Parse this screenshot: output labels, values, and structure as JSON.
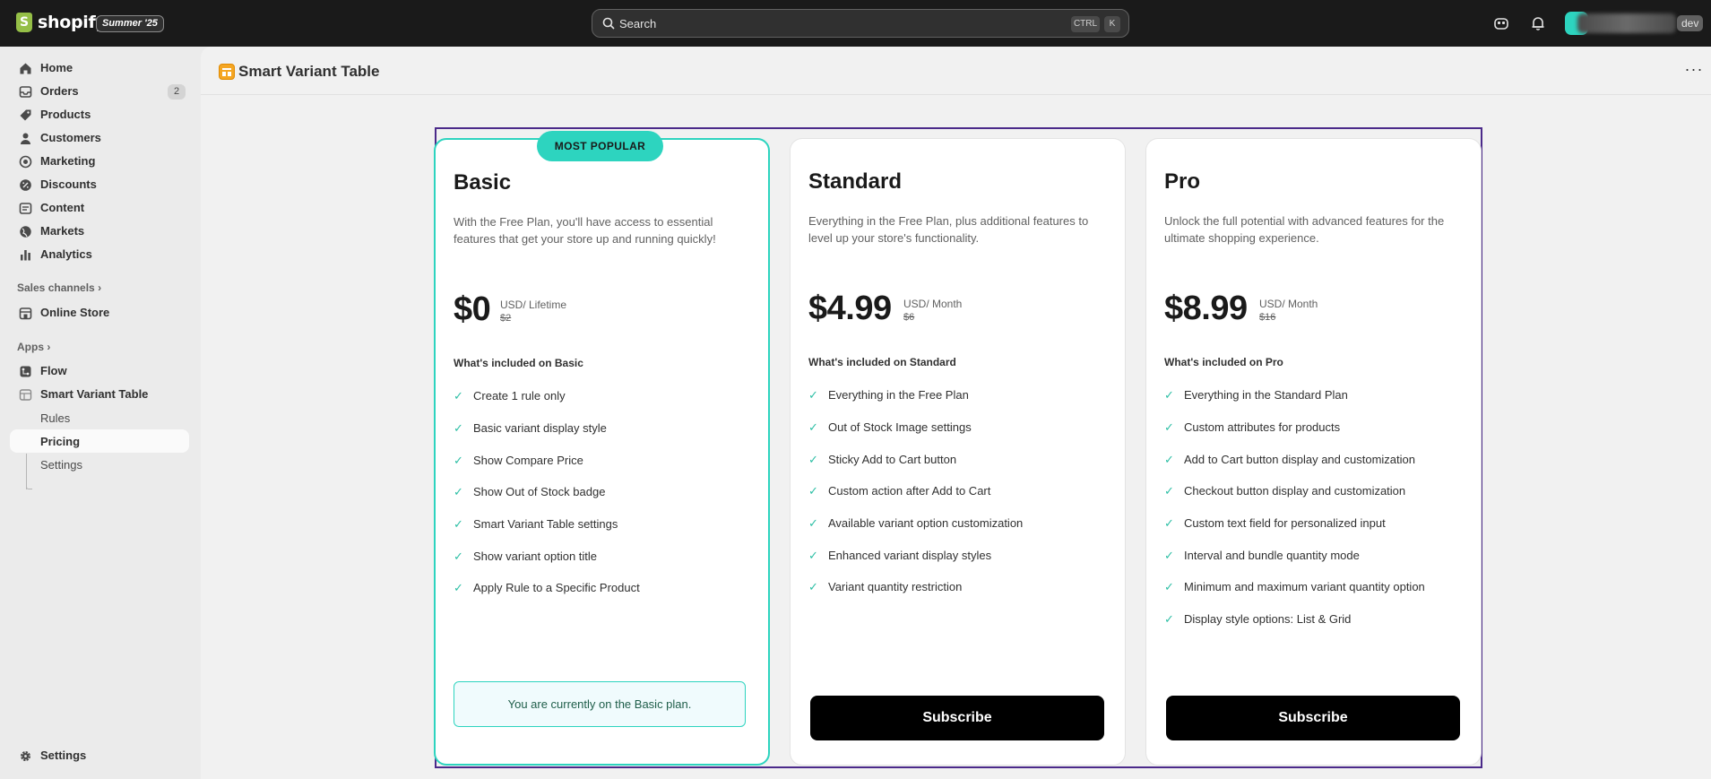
{
  "topbar": {
    "brand": "shopify",
    "edition": "Summer '25",
    "search_placeholder": "Search",
    "kbd_ctrl": "CTRL",
    "kbd_k": "K",
    "dev_badge": "dev"
  },
  "sidebar": {
    "items": [
      {
        "label": "Home",
        "icon": "home-icon"
      },
      {
        "label": "Orders",
        "icon": "orders-icon",
        "badge": "2"
      },
      {
        "label": "Products",
        "icon": "tag-icon"
      },
      {
        "label": "Customers",
        "icon": "person-icon"
      },
      {
        "label": "Marketing",
        "icon": "target-icon"
      },
      {
        "label": "Discounts",
        "icon": "discount-icon"
      },
      {
        "label": "Content",
        "icon": "content-icon"
      },
      {
        "label": "Markets",
        "icon": "globe-icon"
      },
      {
        "label": "Analytics",
        "icon": "chart-icon"
      }
    ],
    "sales_channels_label": "Sales channels",
    "online_store": "Online Store",
    "apps_label": "Apps",
    "flow": "Flow",
    "app_name": "Smart Variant Table",
    "sub_items": [
      "Rules",
      "Pricing",
      "Settings"
    ],
    "settings": "Settings"
  },
  "page": {
    "title": "Smart Variant Table",
    "more": "···"
  },
  "plans": [
    {
      "name": "Basic",
      "badge": "MOST POPULAR",
      "desc": "With the Free Plan, you'll have access to essential features that get your store up and running quickly!",
      "price": "$0",
      "unit": "USD/ Lifetime",
      "old_price": "$2",
      "incl_title": "What's included on Basic",
      "features": [
        "Create 1 rule only",
        "Basic variant display style",
        "Show Compare Price",
        "Show Out of Stock badge",
        "Smart Variant Table settings",
        "Show variant option title",
        "Apply Rule to a Specific Product"
      ],
      "current_note": "You are currently on the Basic plan."
    },
    {
      "name": "Standard",
      "desc": "Everything in the Free Plan, plus additional features to level up your store's functionality.",
      "price": "$4.99",
      "unit": "USD/ Month",
      "old_price": "$6",
      "incl_title": "What's included on Standard",
      "features": [
        "Everything in the Free Plan",
        "Out of Stock Image settings",
        "Sticky Add to Cart button",
        "Custom action after Add to Cart",
        "Available variant option customization",
        "Enhanced variant display styles",
        "Variant quantity restriction"
      ],
      "button": "Subscribe"
    },
    {
      "name": "Pro",
      "desc": "Unlock the full potential with advanced features for the ultimate shopping experience.",
      "price": "$8.99",
      "unit": "USD/ Month",
      "old_price": "$16",
      "incl_title": "What's included on Pro",
      "features": [
        "Everything in the Standard Plan",
        "Custom attributes for products",
        "Add to Cart button display and customization",
        "Checkout button display and customization",
        "Custom text field for personalized input",
        "Interval and bundle quantity mode",
        "Minimum and maximum variant quantity option",
        "Display style options: List & Grid"
      ],
      "button": "Subscribe"
    }
  ],
  "check_glyph": "✓",
  "colors": {
    "accent": "#2dd4bf",
    "frame": "#4b2a8a",
    "topbar": "#1a1a1a"
  }
}
